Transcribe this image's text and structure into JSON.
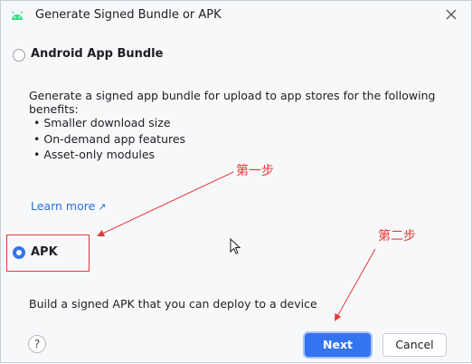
{
  "dialog": {
    "title": "Generate Signed Bundle or APK"
  },
  "options": {
    "bundle": {
      "label": "Android App Bundle",
      "selected": false,
      "description": "Generate a signed app bundle for upload to app stores for the following benefits:",
      "benefits": [
        "Smaller download size",
        "On-demand app features",
        "Asset-only modules"
      ],
      "learn_more": "Learn more"
    },
    "apk": {
      "label": "APK",
      "selected": true,
      "description": "Build a signed APK that you can deploy to a device"
    }
  },
  "annotations": {
    "step1": "第一步",
    "step2": "第二步",
    "color": "#e53935"
  },
  "footer": {
    "help": "?",
    "next": "Next",
    "cancel": "Cancel"
  },
  "colors": {
    "accent": "#3574f0",
    "link": "#2c6fd6"
  }
}
